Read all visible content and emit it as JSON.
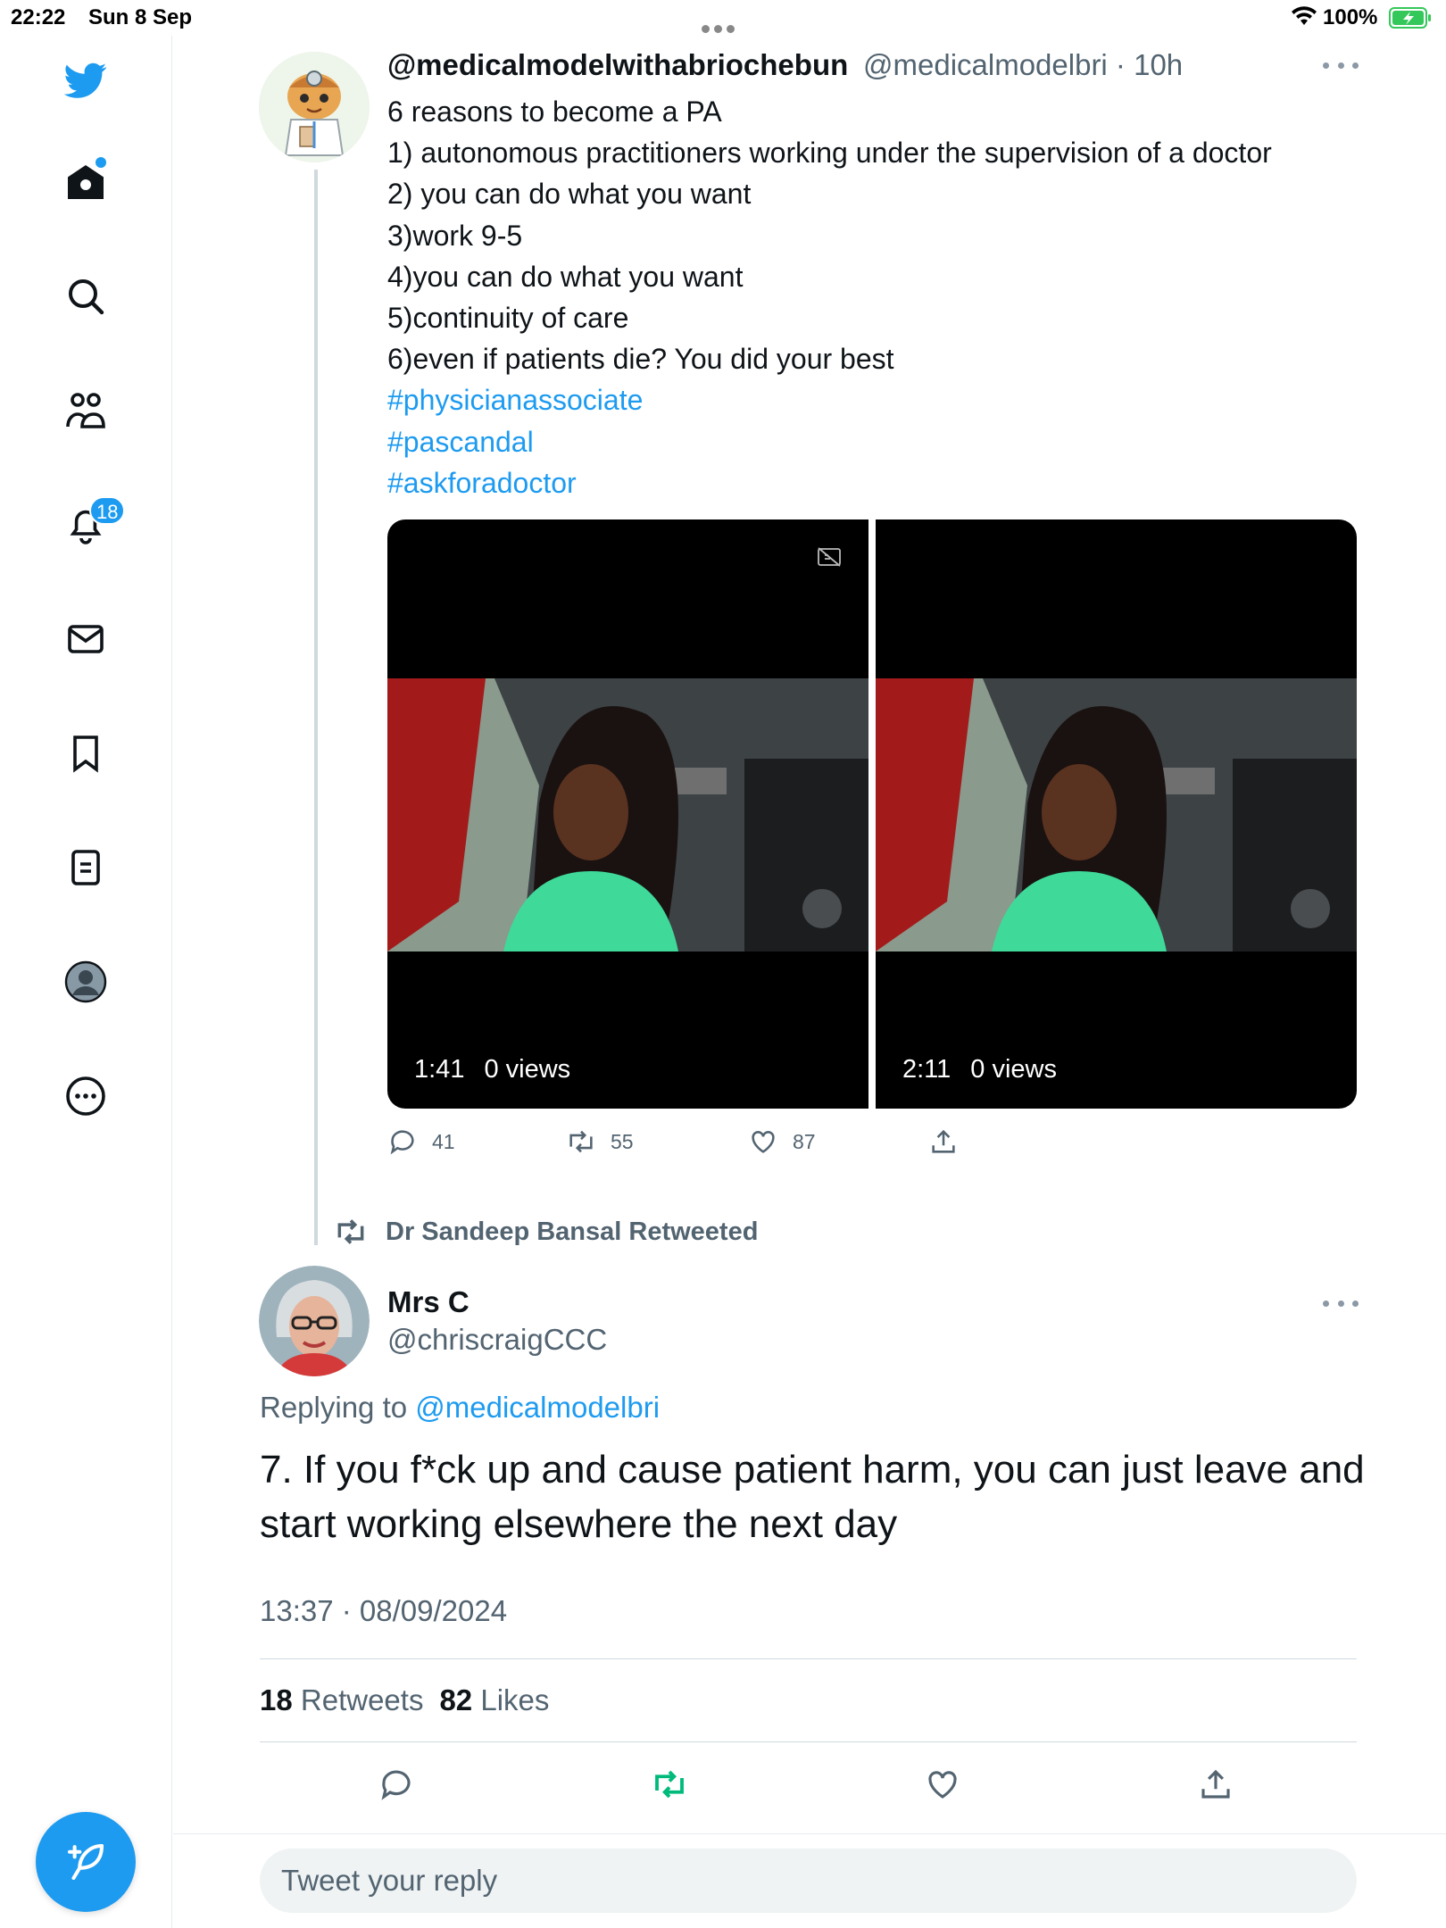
{
  "status_bar": {
    "time": "22:22",
    "date": "Sun 8 Sep",
    "battery": "100%"
  },
  "sidebar": {
    "notifications_badge": "18",
    "accent": "#1d9bf0"
  },
  "tweet1": {
    "display_name": "@medicalmodelwithabriochebun",
    "handle_time": "@medicalmodelbri · 10h",
    "lines": [
      "6 reasons to become a PA",
      "1) autonomous practitioners working under the supervision of a doctor",
      "2) you can do what you want",
      "3)work 9-5",
      "4)you can do what you want",
      "5)continuity of care",
      "6)even if patients die? You did your best"
    ],
    "hashtags": [
      "#physicianassociate",
      "#pascandal",
      "#askforadoctor"
    ],
    "videos": [
      {
        "duration": "1:41",
        "views": "0 views"
      },
      {
        "duration": "2:11",
        "views": "0 views"
      }
    ],
    "replies": "41",
    "retweets": "55",
    "likes": "87"
  },
  "retweet_banner": "Dr Sandeep Bansal Retweeted",
  "tweet2": {
    "display_name": "Mrs C",
    "handle": "@chriscraigCCC",
    "replying_prefix": "Replying to ",
    "replying_to": "@medicalmodelbri",
    "text": "7. If you f*ck up and cause patient harm,  you can just leave and start working elsewhere the next day",
    "timestamp": "13:37 · 08/09/2024",
    "retweet_count": "18",
    "retweet_label": "Retweets",
    "like_count": "82",
    "like_label": "Likes"
  },
  "reply_placeholder": "Tweet your reply"
}
